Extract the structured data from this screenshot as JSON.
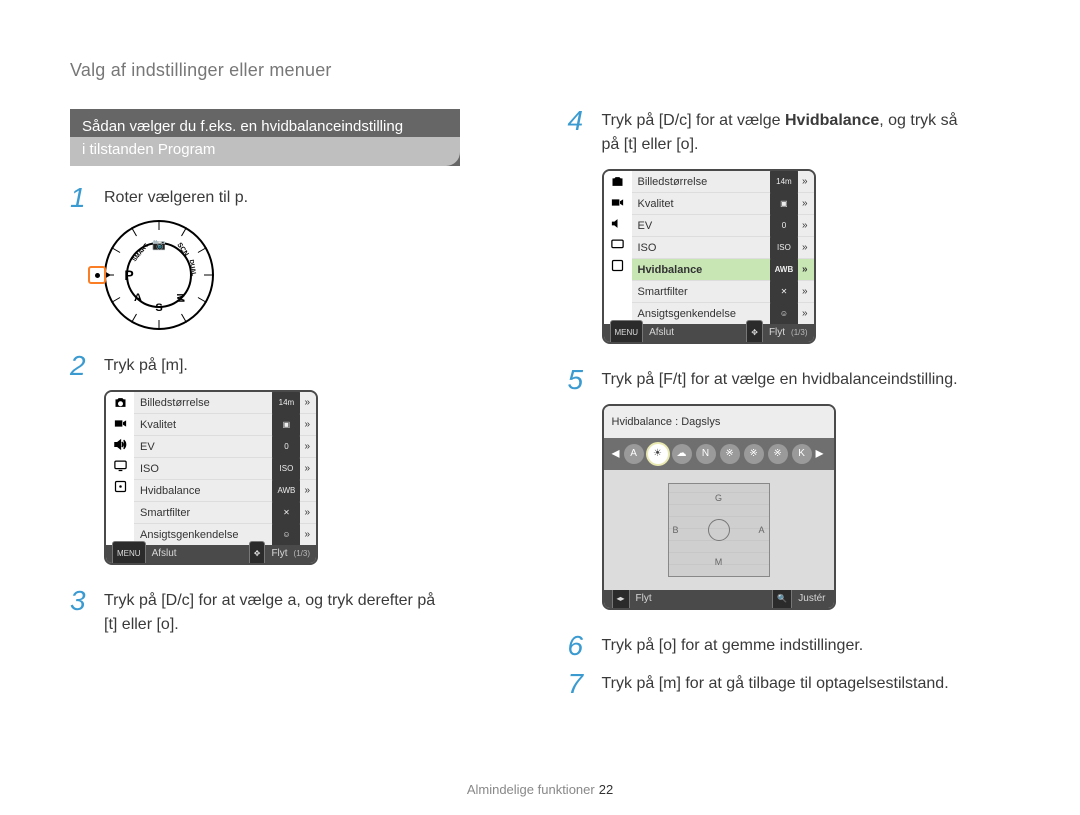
{
  "header": "Valg af indstillinger eller menuer",
  "subtitle": {
    "top": "Sådan vælger du f.eks. en hvidbalanceindstilling",
    "bot": "i tilstanden Program"
  },
  "dial": {
    "labels": {
      "top": "SCN",
      "topright": "DUAL",
      "right": "SMART",
      "bottom": "S",
      "bottomleft": "A",
      "left": "P",
      "topleft": "M"
    }
  },
  "steps": {
    "s1_pre": "Roter vælgeren til ",
    "s1_g": "p",
    "s1_post": ".",
    "s2_pre": "Tryk på [",
    "s2_g": "m",
    "s2_post": "].",
    "s3_p1": "Tryk på [",
    "s3_g1": "D",
    "s3_sep1": "/",
    "s3_g2": "c",
    "s3_p2": "] for at vælge ",
    "s3_g3": "a",
    "s3_p3": ", og tryk derefter på",
    "s3_line2_pre": "[",
    "s3_line2_g1": "t",
    "s3_line2_mid": "] eller [",
    "s3_line2_g2": "o",
    "s3_line2_post": "].",
    "s4_p1": "Tryk på [",
    "s4_g1": "D",
    "s4_sep1": "/",
    "s4_g2": "c",
    "s4_p2": "] for at vælge ",
    "s4_bold": "Hvidbalance",
    "s4_p3": ", og tryk så",
    "s4_l2_pre": "på [",
    "s4_l2_g1": "t",
    "s4_l2_mid": "] eller [",
    "s4_l2_g2": "o",
    "s4_l2_post": "].",
    "s5_p1": "Tryk på [",
    "s5_g1": "F",
    "s5_sep1": "/",
    "s5_g2": "t",
    "s5_p2": "] for at vælge en hvidbalanceindstilling.",
    "s6_p1": "Tryk på [",
    "s6_g1": "o",
    "s6_p2": "] for at gemme indstillinger.",
    "s7_p1": "Tryk på [",
    "s7_g1": "m",
    "s7_p2": "] for at gå tilbage til optagelsestilstand."
  },
  "menuA": {
    "items": [
      {
        "label": "Billedstørrelse",
        "val": "14m",
        "arrow": true
      },
      {
        "label": "Kvalitet",
        "val": "▣",
        "arrow": true
      },
      {
        "label": "EV",
        "val": "0",
        "arrow": true
      },
      {
        "label": "ISO",
        "val": "ISO",
        "arrow": true
      },
      {
        "label": "Hvidbalance",
        "val": "AWB",
        "arrow": true
      },
      {
        "label": "Smartfilter",
        "val": "✕",
        "arrow": true
      },
      {
        "label": "Ansigtsgenkendelse",
        "val": "☺",
        "arrow": true
      }
    ],
    "footer": {
      "btn1text": "MENU",
      "l1": "Afslut",
      "l2": "Flyt",
      "page": "(1/3)"
    }
  },
  "menuB": {
    "items": [
      {
        "label": "Billedstørrelse",
        "val": "14m",
        "arrow": true,
        "hi": false
      },
      {
        "label": "Kvalitet",
        "val": "▣",
        "arrow": true,
        "hi": false
      },
      {
        "label": "EV",
        "val": "0",
        "arrow": true,
        "hi": false
      },
      {
        "label": "ISO",
        "val": "ISO",
        "arrow": true,
        "hi": false
      },
      {
        "label": "Hvidbalance",
        "val": "AWB",
        "arrow": true,
        "hi": true
      },
      {
        "label": "Smartfilter",
        "val": "✕",
        "arrow": true,
        "hi": false
      },
      {
        "label": "Ansigtsgenkendelse",
        "val": "☺",
        "arrow": true,
        "hi": false
      }
    ],
    "footer": {
      "btn1text": "MENU",
      "l1": "Afslut",
      "l2": "Flyt",
      "page": "(1/3)"
    }
  },
  "wb": {
    "header": "Hvidbalance : Dagslys",
    "chips": [
      "A",
      "☀",
      "☁",
      "N",
      "※",
      "※",
      "※",
      "K"
    ],
    "selectedIndex": 1,
    "grid": {
      "g": "G",
      "m": "M",
      "b": "B",
      "a": "A"
    },
    "footer": {
      "l1": "Flyt",
      "l2": "Justér"
    }
  },
  "pageFooter": {
    "text": "Almindelige funktioner",
    "no": "22"
  }
}
